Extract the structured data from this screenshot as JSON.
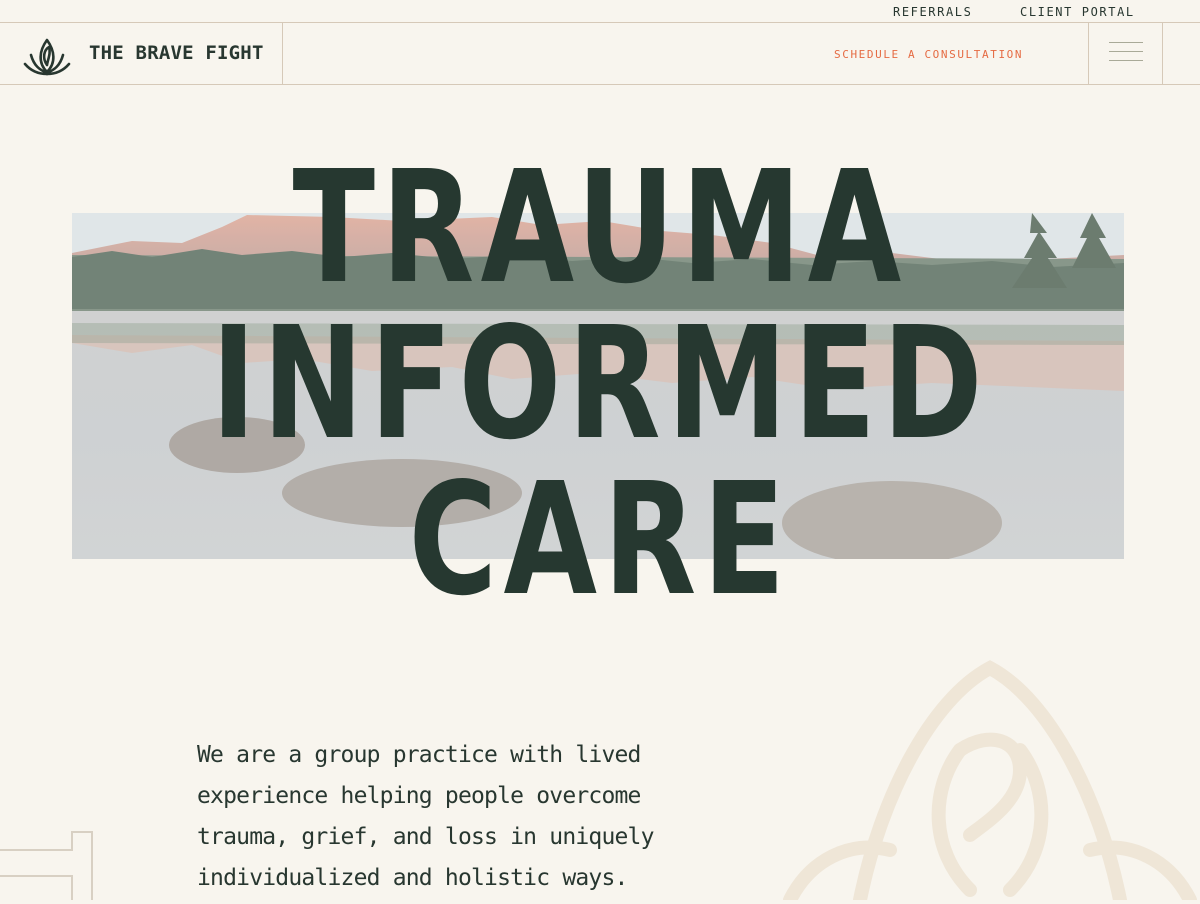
{
  "top_bar": {
    "referrals_label": "REFERRALS",
    "client_portal_label": "CLIENT PORTAL"
  },
  "header": {
    "brand_name": "THE BRAVE FIGHT",
    "logo_icon": "lotus-flame-icon",
    "consult_label": "SCHEDULE A CONSULTATION",
    "menu_icon": "hamburger-menu-icon"
  },
  "hero": {
    "title_lines": [
      "TRAUMA",
      "INFORMED",
      "CARE"
    ],
    "image_description": ""
  },
  "intro": {
    "text": "We are a group practice with lived experience helping people overcome trauma, grief, and loss in uniquely individualized and holistic ways."
  },
  "colors": {
    "background": "#f8f5ee",
    "text_dark": "#283730",
    "accent": "#e56b43",
    "divider": "#d6c9b8",
    "emblem": "#efe6d7"
  }
}
